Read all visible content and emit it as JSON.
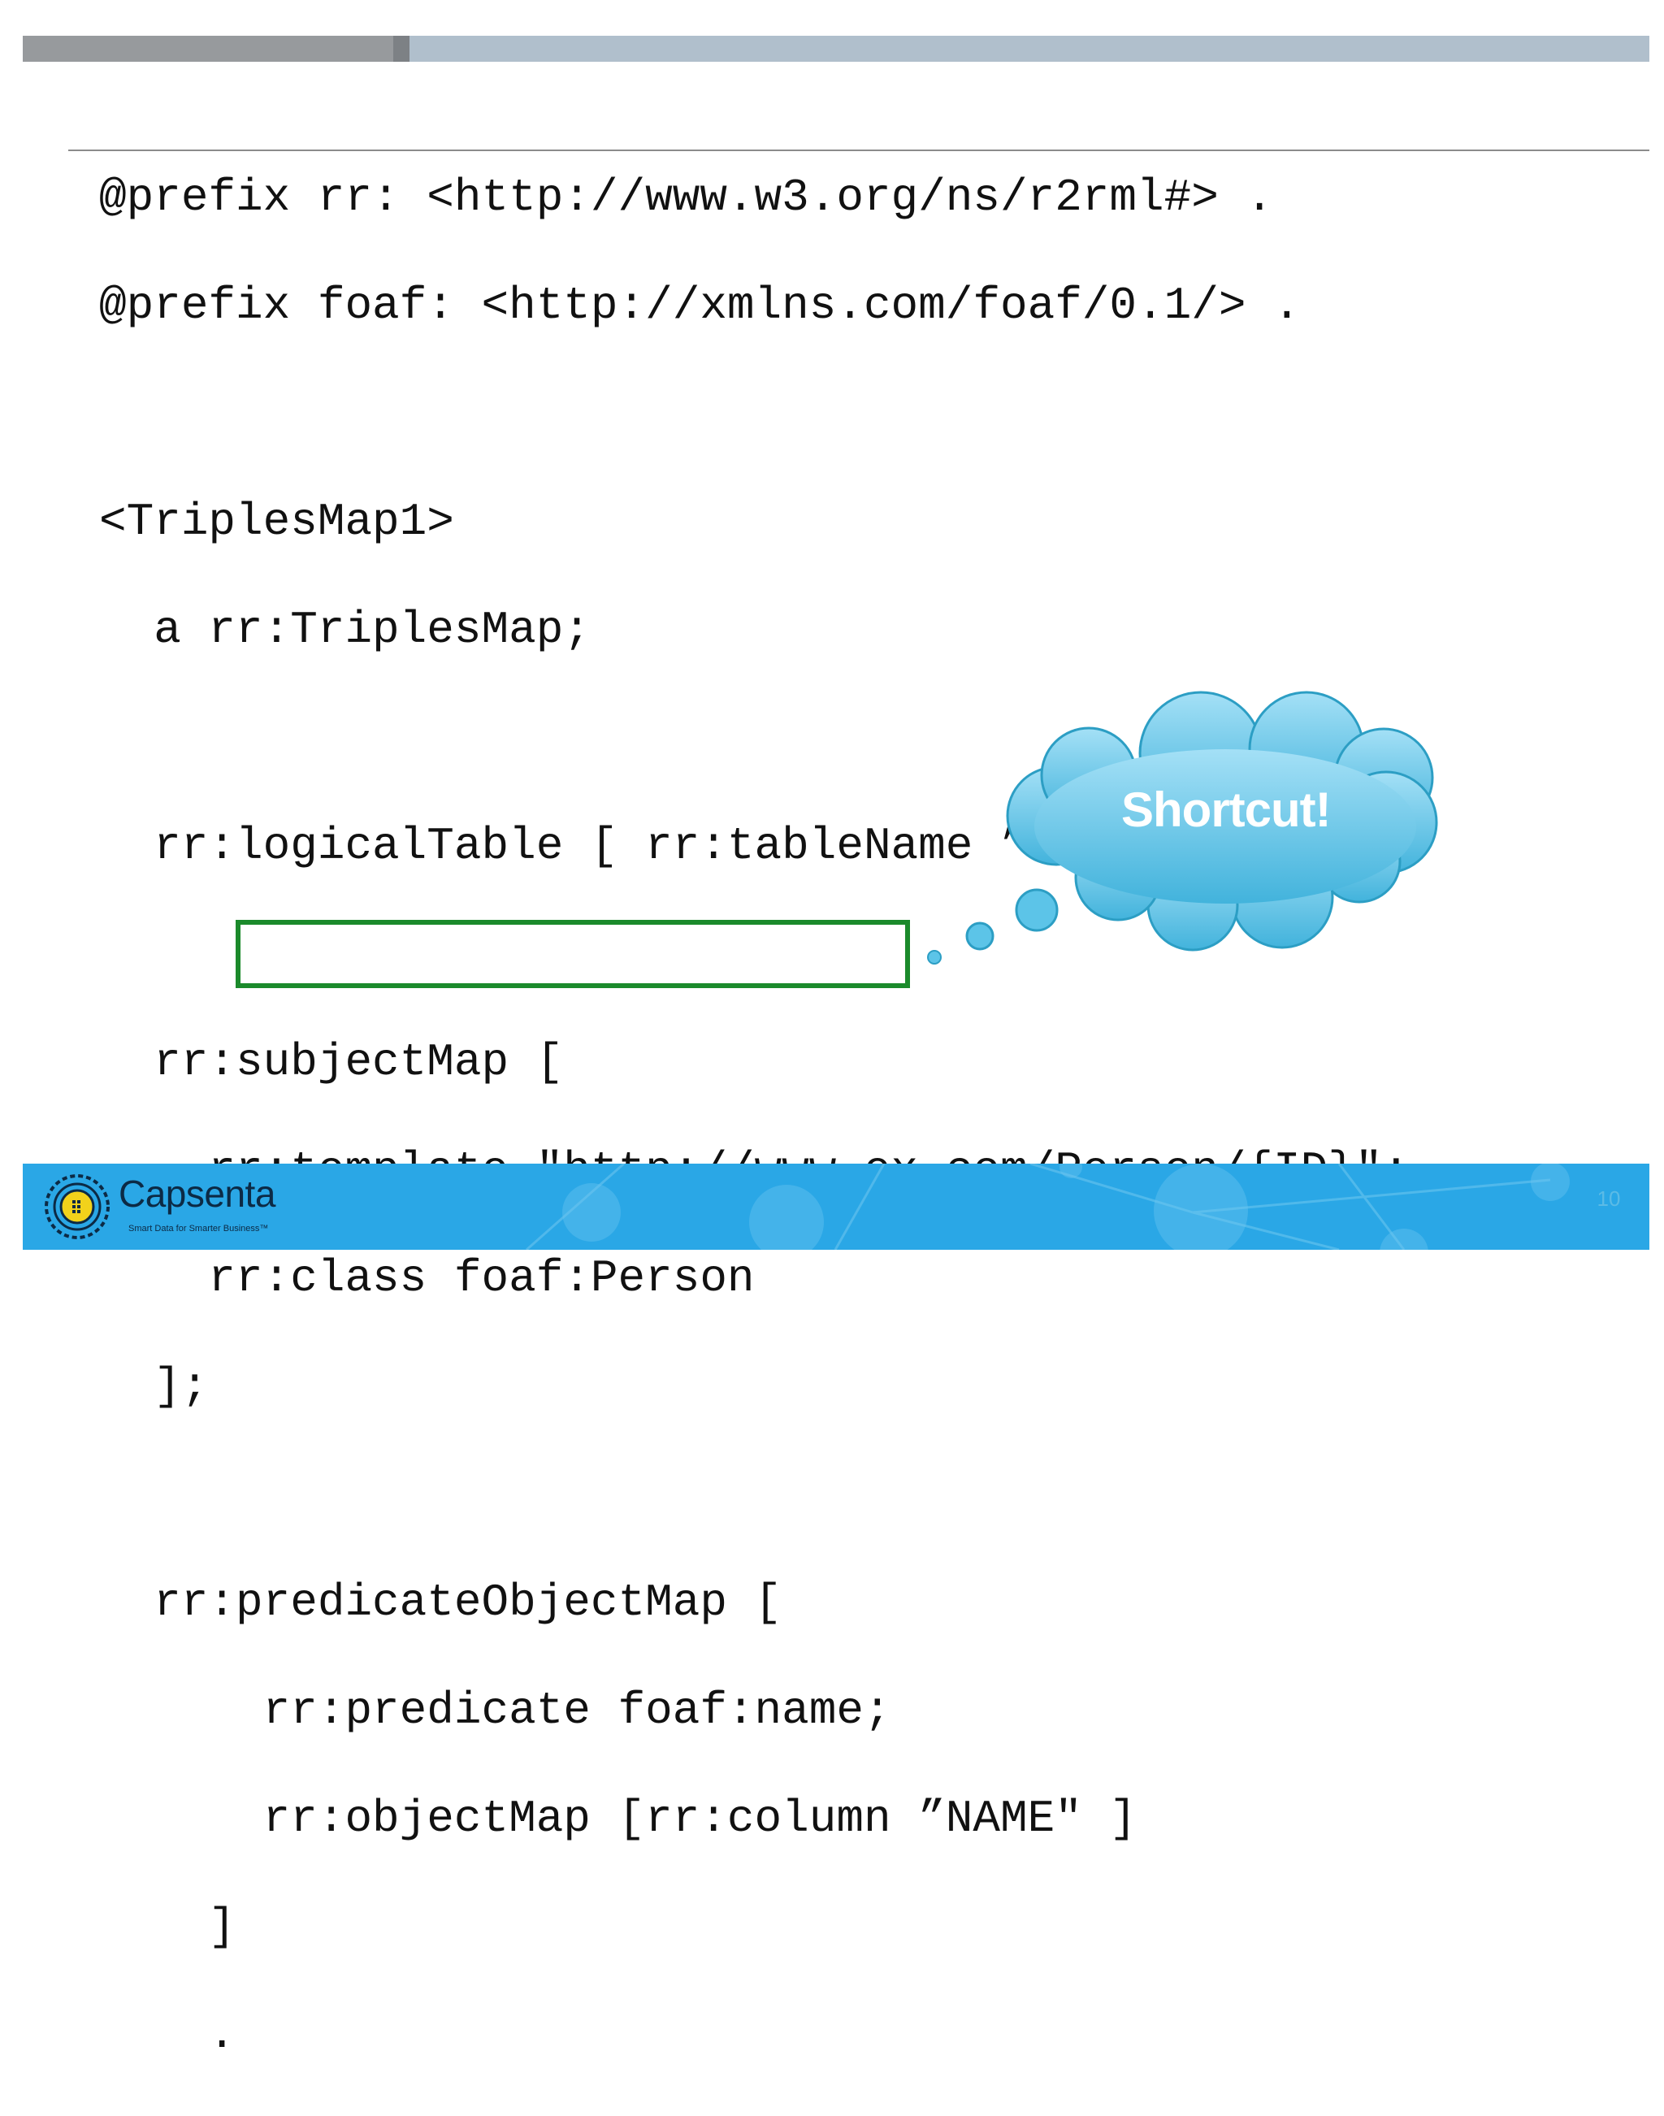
{
  "header": {
    "bar_colors": {
      "dark": "#979a9d",
      "accent": "#7d8185",
      "light": "#b0bfcc"
    }
  },
  "code": {
    "lines": [
      "@prefix rr: <http://www.w3.org/ns/r2rml#> .",
      "@prefix foaf: <http://xmlns.com/foaf/0.1/> .",
      "",
      "<TriplesMap1>",
      "  a rr:TriplesMap;",
      "",
      "  rr:logicalTable [ rr:tableName ”Person”];",
      "",
      "  rr:subjectMap [",
      "    rr:template \"http://www.ex.com/Person/{ID}\";",
      "    rr:class foaf:Person",
      "  ];",
      "",
      "  rr:predicateObjectMap [",
      "      rr:predicate foaf:name;",
      "      rr:objectMap [rr:column ”NAME\" ]",
      "    ]",
      "    ."
    ],
    "highlighted_line": "rr:predicate foaf:name;",
    "highlight_color": "#1b8a2b"
  },
  "callout": {
    "text": "Shortcut!",
    "fill_color": "#5cc4e8",
    "stroke_color": "#2c9ec4"
  },
  "footer": {
    "brand_name": "Capsenta",
    "tagline": "Smart Data for Smarter Business™",
    "page_number": "10",
    "background_color": "#2aa7e6"
  }
}
